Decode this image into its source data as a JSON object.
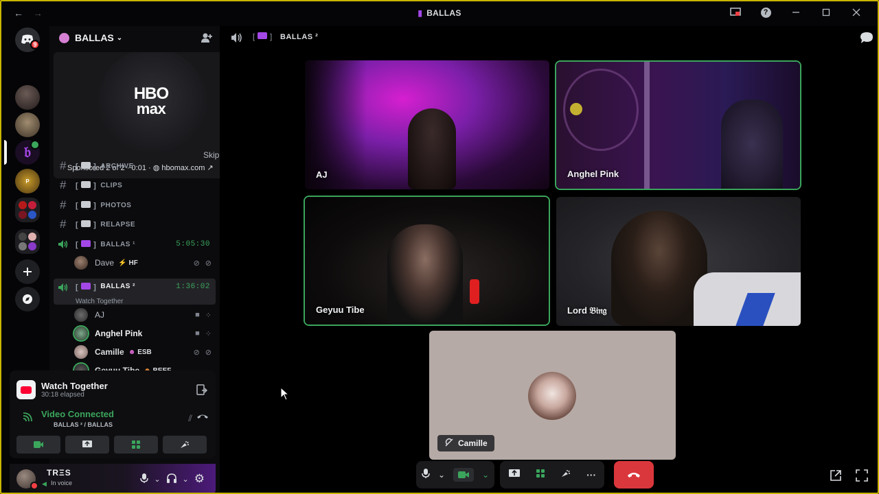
{
  "window": {
    "title": "BALLAS"
  },
  "rail": {
    "badge_count": "9"
  },
  "server": {
    "name": "BALLAS"
  },
  "main_header": {
    "channel_name": "BALLAS ²"
  },
  "ad": {
    "brand_line1": "HBO",
    "brand_line2": "max",
    "skip_label": "Skip",
    "sponsor_text": "Sponsored 2 of 2 · 0:01 · ",
    "sponsor_link": "hbomax.com"
  },
  "channels": [
    {
      "name": "ARCHIVE"
    },
    {
      "name": "CLIPS"
    },
    {
      "name": "PHOTOS"
    },
    {
      "name": "RELAPSE"
    }
  ],
  "voice_channels": [
    {
      "name": "BALLAS ¹",
      "timer": "5:05:30"
    },
    {
      "name": "BALLAS ²",
      "timer": "1:36:02",
      "activity": "Watch Together"
    }
  ],
  "voice_users": [
    {
      "name": "Dave",
      "tag": "HF"
    },
    {
      "name": "AJ"
    },
    {
      "name": "Anghel Pink"
    },
    {
      "name": "Camille",
      "tag": "ESB"
    },
    {
      "name": "Geyuu Tibe",
      "tag": "BEEF"
    }
  ],
  "activity_panel": {
    "title": "Watch Together",
    "elapsed": "30:18 elapsed"
  },
  "voice_panel": {
    "status": "Video Connected",
    "location": "BALLAS ² / BALLAS"
  },
  "user": {
    "name": "TRΞS",
    "status": "In voice"
  },
  "tiles": [
    {
      "name": "AJ"
    },
    {
      "name": "Anghel Pink"
    },
    {
      "name": "Geyuu Tibe"
    },
    {
      "name": "Lord 𝔅𝔦𝔫𝔤"
    },
    {
      "name": "Camille"
    }
  ],
  "colors": {
    "accent_green": "#3ba55c",
    "end_call": "#da373c",
    "purple": "#a347e6"
  }
}
